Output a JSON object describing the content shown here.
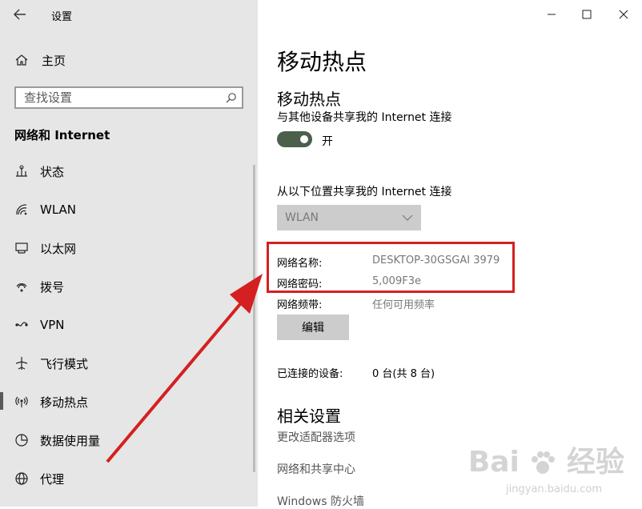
{
  "window": {
    "title": "设置"
  },
  "sidebar": {
    "home_label": "主页",
    "search_placeholder": "查找设置",
    "section_title": "网络和 Internet",
    "items": [
      {
        "label": "状态",
        "icon": "status-icon"
      },
      {
        "label": "WLAN",
        "icon": "wifi-icon"
      },
      {
        "label": "以太网",
        "icon": "ethernet-icon"
      },
      {
        "label": "拨号",
        "icon": "dialup-icon"
      },
      {
        "label": "VPN",
        "icon": "vpn-icon"
      },
      {
        "label": "飞行模式",
        "icon": "airplane-icon"
      },
      {
        "label": "移动热点",
        "icon": "hotspot-icon",
        "active": true
      },
      {
        "label": "数据使用量",
        "icon": "data-usage-icon"
      },
      {
        "label": "代理",
        "icon": "globe-icon"
      }
    ]
  },
  "main": {
    "page_title": "移动热点",
    "hotspot_heading": "移动热点",
    "share_desc": "与其他设备共享我的 Internet 连接",
    "toggle_state": "开",
    "toggle_on": true,
    "share_from_label": "从以下位置共享我的 Internet 连接",
    "share_from_value": "WLAN",
    "network_name_label": "网络名称:",
    "network_name_value": "DESKTOP-30GSGAI 3979",
    "network_password_label": "网络密码:",
    "network_password_value": "5,009F3e",
    "network_band_label": "网络频带:",
    "network_band_value": "任何可用频率",
    "edit_button": "编辑",
    "connected_label": "已连接的设备:",
    "connected_value": "0 台(共 8 台)",
    "related_heading": "相关设置",
    "related_links": [
      "更改适配器选项",
      "网络和共享中心",
      "Windows 防火墙"
    ]
  },
  "watermark": {
    "text": "Bai",
    "text2": "经验",
    "url": "jingyan.baidu.com"
  },
  "colors": {
    "sidebar_bg": "#e6e6e6",
    "toggle_on": "#4b5f4b",
    "highlight": "#d42020"
  }
}
